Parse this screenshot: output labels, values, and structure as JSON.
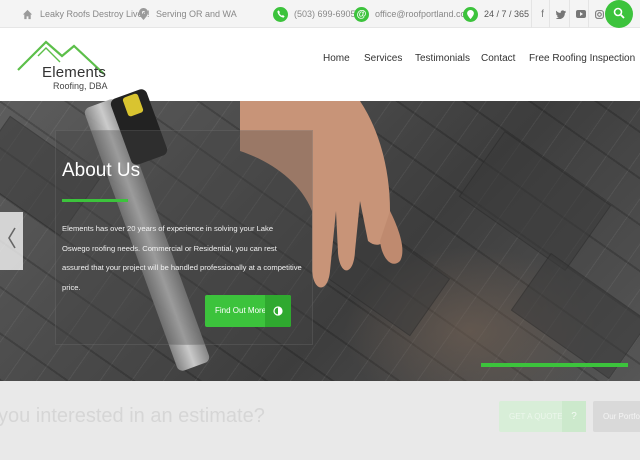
{
  "topbar": {
    "tagline": "Leaky Roofs Destroy Lives!",
    "service_area": "Serving OR and WA",
    "phone": "(503) 699-6905",
    "email": "office@roofportland.com",
    "hours": "24 / 7 / 365",
    "social_icons": [
      "facebook-icon",
      "twitter-icon",
      "youtube-icon",
      "instagram-icon"
    ],
    "accent_color": "#3cc33c"
  },
  "header": {
    "logo_name": "Elements",
    "logo_sub": "Roofing, DBA",
    "nav": [
      "Home",
      "Services",
      "Testimonials",
      "Contact",
      "Free Roofing Inspection"
    ]
  },
  "hero": {
    "title": "About Us",
    "body": "Elements has over 20 years of experience in solving your Lake Oswego roofing needs. Commercial or Residential, you can rest assured that your project will be handled professionally at a competitive price.",
    "button_label": "Find Out More"
  },
  "estimate": {
    "question": "you interested in an estimate?",
    "quote_button": "GET A QUOTE",
    "portfolio_button": "Our Portfolio"
  }
}
